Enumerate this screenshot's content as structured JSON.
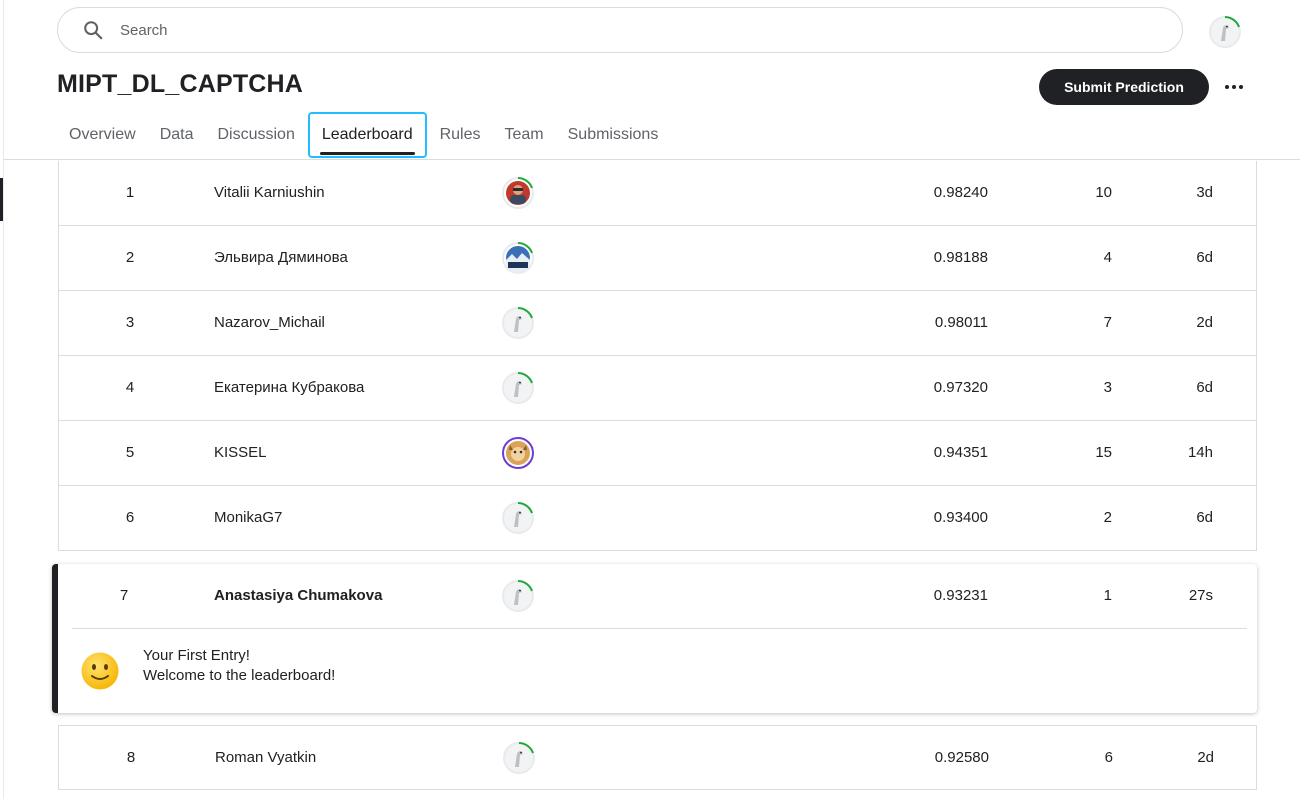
{
  "search": {
    "placeholder": "Search"
  },
  "competition": {
    "title": "MIPT_DL_CAPTCHA"
  },
  "actions": {
    "submit_label": "Submit Prediction"
  },
  "tabs": [
    {
      "label": "Overview"
    },
    {
      "label": "Data"
    },
    {
      "label": "Discussion"
    },
    {
      "label": "Leaderboard",
      "active": true
    },
    {
      "label": "Rules"
    },
    {
      "label": "Team"
    },
    {
      "label": "Submissions"
    }
  ],
  "leaderboard": {
    "rows": [
      {
        "rank": "1",
        "name": "Vitalii Karniushin",
        "avatar": "photo-avatar-red",
        "score": "0.98240",
        "entries": "10",
        "last": "3d"
      },
      {
        "rank": "2",
        "name": "Эльвира Дяминова",
        "avatar": "photo-avatar-landscape",
        "score": "0.98188",
        "entries": "4",
        "last": "6d"
      },
      {
        "rank": "3",
        "name": "Nazarov_Michail",
        "avatar": "default-avatar",
        "score": "0.98011",
        "entries": "7",
        "last": "2d"
      },
      {
        "rank": "4",
        "name": "Екатерина Кубракова",
        "avatar": "default-avatar",
        "score": "0.97320",
        "entries": "3",
        "last": "6d"
      },
      {
        "rank": "5",
        "name": "KISSEL",
        "avatar": "photo-avatar-cat",
        "score": "0.94351",
        "entries": "15",
        "last": "14h"
      },
      {
        "rank": "6",
        "name": "MonikaG7",
        "avatar": "default-avatar",
        "score": "0.93400",
        "entries": "2",
        "last": "6d"
      }
    ],
    "current_user": {
      "rank": "7",
      "name": "Anastasiya Chumakova",
      "avatar": "default-avatar",
      "score": "0.93231",
      "entries": "1",
      "last": "27s"
    },
    "message": {
      "line1": "Your First Entry!",
      "line2": "Welcome to the leaderboard!",
      "icon": "smiley-emoji"
    },
    "after_rows": [
      {
        "rank": "8",
        "name": "Roman Vyatkin",
        "avatar": "default-avatar",
        "score": "0.92580",
        "entries": "6",
        "last": "2d"
      }
    ]
  },
  "colors": {
    "accent": "#20beff",
    "progress_green": "#20a83a",
    "progress_purple": "#6c3dd6",
    "primary_button": "#202124"
  }
}
